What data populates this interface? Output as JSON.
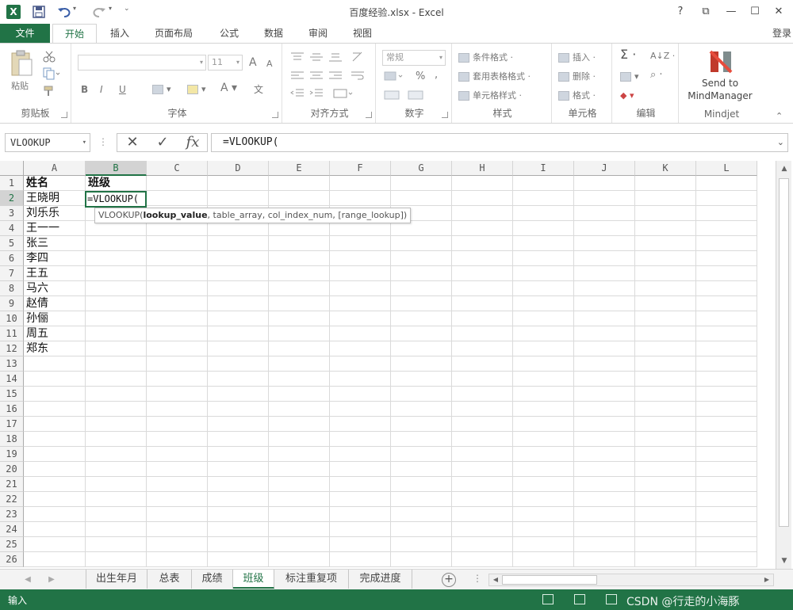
{
  "titlebar": {
    "title": "百度经验.xlsx - Excel",
    "help": "?",
    "ribbon_display": "⧉",
    "minimize": "—",
    "maximize": "☐",
    "close": "✕",
    "undo_dropdown": "▾",
    "redo_dropdown": "▾",
    "qat_more": "⌄"
  },
  "tabs": {
    "file": "文件",
    "items": [
      "开始",
      "插入",
      "页面布局",
      "公式",
      "数据",
      "审阅",
      "视图"
    ],
    "login": "登录"
  },
  "ribbon": {
    "clipboard": {
      "label": "剪贴板",
      "paste": "粘贴"
    },
    "font": {
      "label": "字体",
      "font_name": "",
      "font_size": "11",
      "bold": "B",
      "italic": "I",
      "underline": "U",
      "grow": "A",
      "shrink": "A",
      "phonetic": "文"
    },
    "alignment": {
      "label": "对齐方式"
    },
    "number": {
      "label": "数字",
      "format": "常规",
      "percent": "%",
      "comma": ","
    },
    "styles": {
      "label": "样式",
      "conditional": "条件格式 ·",
      "table": "套用表格格式 ·",
      "cell_styles": "单元格样式 ·"
    },
    "cells": {
      "label": "单元格",
      "insert": "插入 ·",
      "delete": "删除 ·",
      "format": "格式 ·"
    },
    "editing": {
      "label": "编辑",
      "sum": "Σ ·",
      "sort": "A↓Z ·",
      "find": "⌕ ·"
    },
    "mindjet": {
      "label": "Mindjet",
      "send_line1": "Send to",
      "send_line2": "MindManager"
    },
    "collapse": "⌃"
  },
  "formula_bar": {
    "name_box": "VLOOKUP",
    "cancel": "✕",
    "enter": "✓",
    "fx": "fx",
    "formula": "=VLOOKUP("
  },
  "grid": {
    "columns": [
      "A",
      "B",
      "C",
      "D",
      "E",
      "F",
      "G",
      "H",
      "I",
      "J",
      "K",
      "L"
    ],
    "rows": [
      "1",
      "2",
      "3",
      "4",
      "5",
      "6",
      "7",
      "8",
      "9",
      "10",
      "11",
      "12",
      "13",
      "14",
      "15",
      "16",
      "17",
      "18",
      "19",
      "20",
      "21",
      "22",
      "23",
      "24",
      "25",
      "26"
    ],
    "A": [
      "姓名",
      "王晓明",
      "刘乐乐",
      "王一一",
      "张三",
      "李四",
      "王五",
      "马六",
      "赵倩",
      "孙俪",
      "周五",
      "郑东"
    ],
    "B1": "班级",
    "active_cell_text": "=VLOOKUP(",
    "tooltip_prefix": "VLOOKUP(",
    "tooltip_bold": "lookup_value",
    "tooltip_rest": ", table_array, col_index_num, [range_lookup])"
  },
  "sheets": {
    "tabs": [
      "出生年月",
      "总表",
      "成绩",
      "班级",
      "标注重复项",
      "完成进度"
    ],
    "active": "班级",
    "add": "+",
    "prev": "◀",
    "next": "▶",
    "dots": "⋮"
  },
  "status": {
    "mode": "输入",
    "watermark": "CSDN @行走的小海豚"
  },
  "colors": {
    "brand": "#217346"
  }
}
